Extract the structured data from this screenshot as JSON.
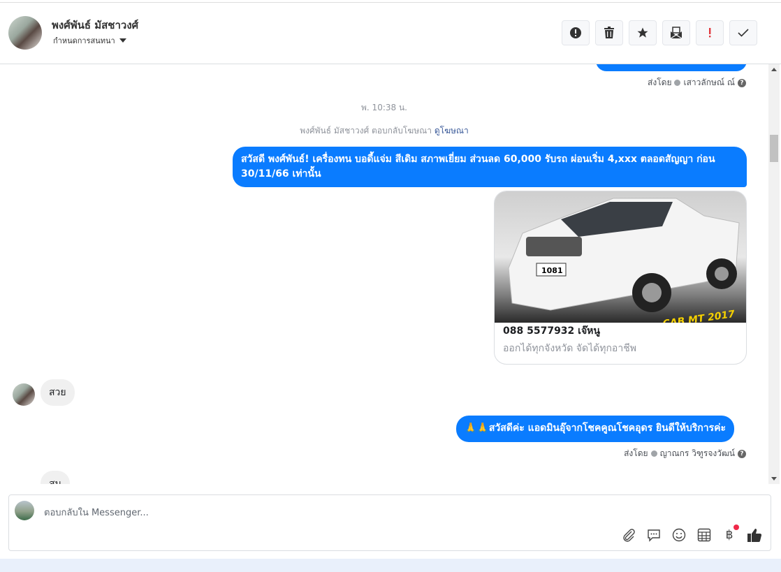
{
  "header": {
    "contact_name": "พงศ์พันธ์ มัสชาวงศ์",
    "assign_label": "กำหนดการสนทนา",
    "actions": [
      "alert-icon",
      "trash-icon",
      "star-icon",
      "mark-unread-icon",
      "important-icon",
      "check-icon"
    ]
  },
  "thread": {
    "prev_meta": {
      "sent_by": "ส่งโดย",
      "agent": "เสาวลักษณ์ ณ์"
    },
    "timestamp": "พ. 10:38 น.",
    "ad_reply": {
      "text": "พงศ์พันธ์ มัสชาวงศ์ ตอบกลับโฆษณา",
      "link": "ดูโฆษณา"
    },
    "msg1": "สวัสดี พงศ์พันธ์! เครื่องทน บอดี้แจ่ม สีเดิม สภาพเยี่ยม ส่วนลด 60,000 รับรถ ผ่อนเริ่ม 4,xxx ตลอดสัญญา ก่อน 30/11/66 เท่านั้น",
    "card": {
      "title": "088 5577932 เจ๊หนู",
      "subtitle": "ออกได้ทุกจังหวัด จัดได้ทุกอาชีพ",
      "image_caption": "CAB MT 2017"
    },
    "in1": "สวย",
    "msg2": "🙏🙏สวัสดีค่ะ แอดมินอุ๊จากโชคคูณโชคอุดร ยินดีให้บริการค่ะ",
    "msg2_meta": {
      "sent_by": "ส่งโดย",
      "agent": "ญาณกร วิฑูรจงวัฒน์"
    },
    "in2": "สน"
  },
  "composer": {
    "placeholder": "ตอบกลับใน Messenger..."
  },
  "colors": {
    "accent": "#0a7cff",
    "badge": "#f02849"
  }
}
